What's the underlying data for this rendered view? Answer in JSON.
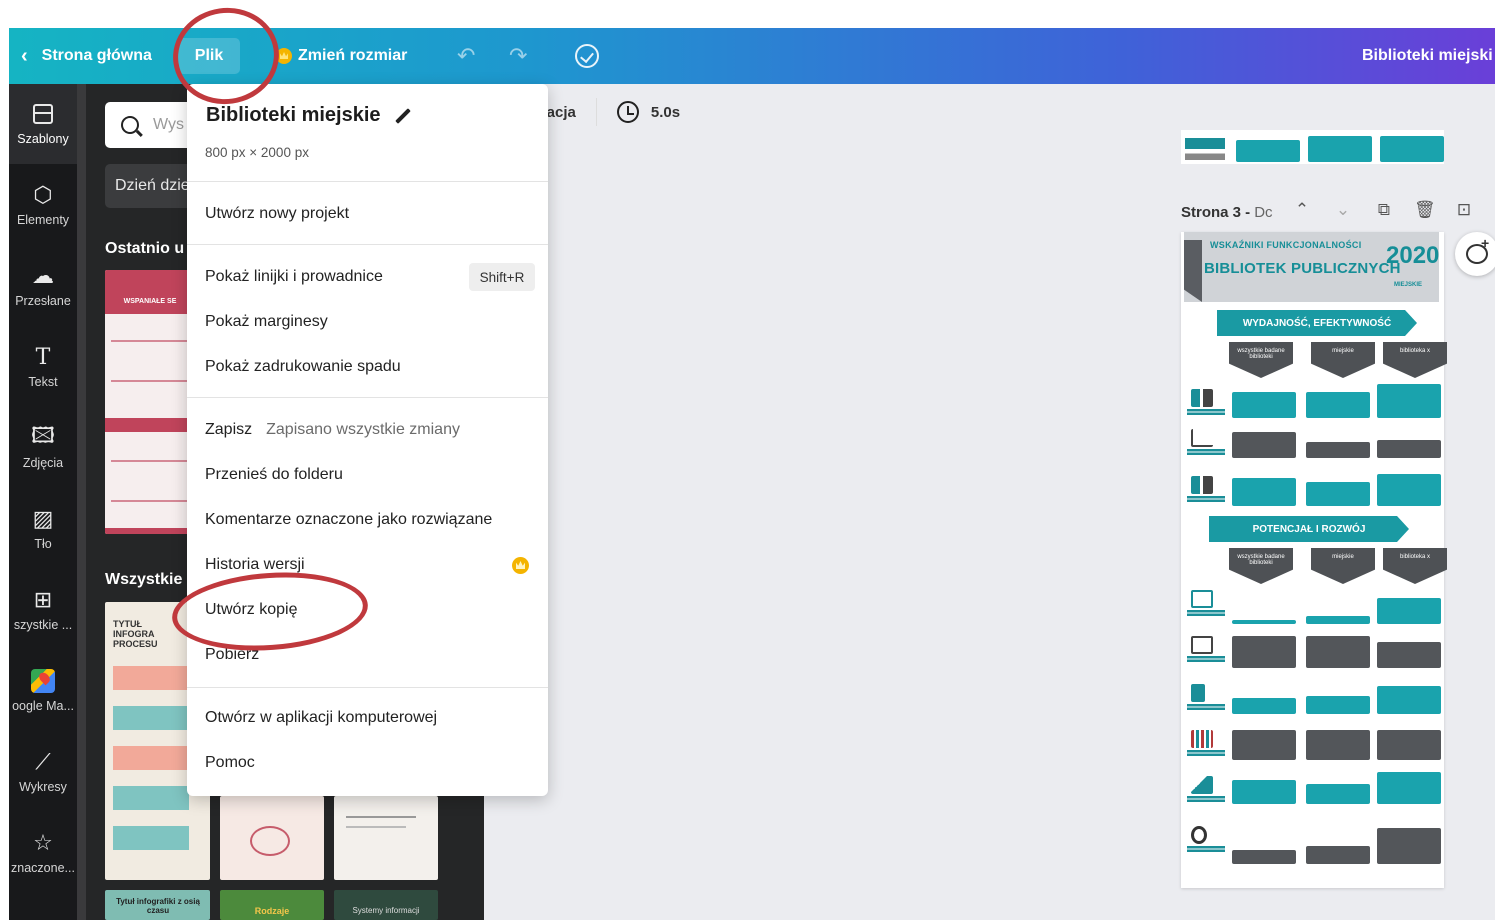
{
  "topbar": {
    "home_label": "Strona główna",
    "file_label": "Plik",
    "resize_label": "Zmień rozmiar",
    "project_title": "Biblioteki miejski"
  },
  "rail": [
    {
      "label": "Szablony",
      "icon": "template-icon"
    },
    {
      "label": "Elementy",
      "icon": "shapes-icon"
    },
    {
      "label": "Przesłane",
      "icon": "upload-cloud-icon"
    },
    {
      "label": "Tekst",
      "icon": "text-icon"
    },
    {
      "label": "Zdjęcia",
      "icon": "photo-icon"
    },
    {
      "label": "Tło",
      "icon": "background-icon"
    },
    {
      "label": "szystkie ...",
      "icon": "apps-icon"
    },
    {
      "label": "oogle Ma...",
      "icon": "google-maps-icon"
    },
    {
      "label": "Wykresy",
      "icon": "chart-icon"
    },
    {
      "label": "znaczone...",
      "icon": "star-icon"
    }
  ],
  "panel": {
    "search_placeholder": "Wys",
    "chip": "Dzień dzie",
    "recent_title": "Ostatnio u",
    "all_title": "Wszystkie",
    "thumb1_line": "WSPANIAŁE SE",
    "thumb2_title": "TYTUŁ INFOGRA PROCESU",
    "thumb3_title": "Tytuł infografiki z osią czasu",
    "thumb4_title": "Rodzaje",
    "thumb5_title": "Systemy informacji"
  },
  "subtoolbar": {
    "animation_label": "nimacja",
    "duration": "5.0s"
  },
  "canvas": {
    "page_label": "Strona 3 - ",
    "page_title": "Dc",
    "infographic": {
      "top_line": "WSKAŹNIKI FUNKCJONALNOŚCI",
      "title": "BIBLIOTEK PUBLICZNYCH",
      "year": "2020",
      "subtitle": "MIEJSKIE",
      "section1": "WYDAJNOŚĆ, EFEKTYWNOŚĆ",
      "section2": "POTENCJAŁ I ROZWÓJ",
      "col1": "wszystkie badane biblioteki",
      "col2": "miejskie",
      "col3": "biblioteka x"
    }
  },
  "menu": {
    "title": "Biblioteki miejskie",
    "dimensions": "800 px × 2000 px",
    "items": {
      "new_project": "Utwórz nowy projekt",
      "show_rulers": "Pokaż linijki i prowadnice",
      "show_rulers_shortcut": "Shift+R",
      "show_margins": "Pokaż marginesy",
      "show_bleed": "Pokaż zadrukowanie spadu",
      "save": "Zapisz",
      "save_status": "Zapisano wszystkie zmiany",
      "move_folder": "Przenieś do folderu",
      "resolved_comments": "Komentarze oznaczone jako rozwiązane",
      "version_history": "Historia wersji",
      "make_copy": "Utwórz kopię",
      "download": "Pobierz",
      "open_desktop": "Otwórz w aplikacji komputerowej",
      "help": "Pomoc"
    }
  },
  "colors": {
    "accent_teal": "#1aa3ad",
    "annotation_red": "#c0393d",
    "premium_gold": "#f4b400"
  }
}
